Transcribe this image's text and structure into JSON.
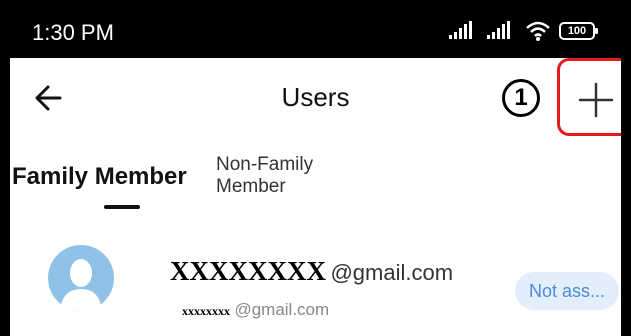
{
  "status_bar": {
    "time": "1:30 PM",
    "battery": "100",
    "icons": [
      "signal-icon",
      "signal-icon",
      "wifi-icon",
      "battery-icon"
    ]
  },
  "header": {
    "title": "Users",
    "back_icon": "arrow-left-icon",
    "add_icon": "plus-icon",
    "step_number": "1"
  },
  "tabs": [
    {
      "label": "Family Member",
      "selected": true
    },
    {
      "label_line1": "Non-Family",
      "label_line2": "Member",
      "selected": false
    }
  ],
  "users": [
    {
      "name": "XXXXXXXX",
      "email_suffix": "@gmail.com",
      "sub_name": "xxxxxxxx",
      "sub_suffix": "@gmail.com",
      "status": "Not ass..."
    }
  ],
  "colors": {
    "highlight": "#e21a1a",
    "avatar": "#8fc2e6",
    "pill_bg": "#e3eefc",
    "pill_text": "#4a8ad8"
  }
}
